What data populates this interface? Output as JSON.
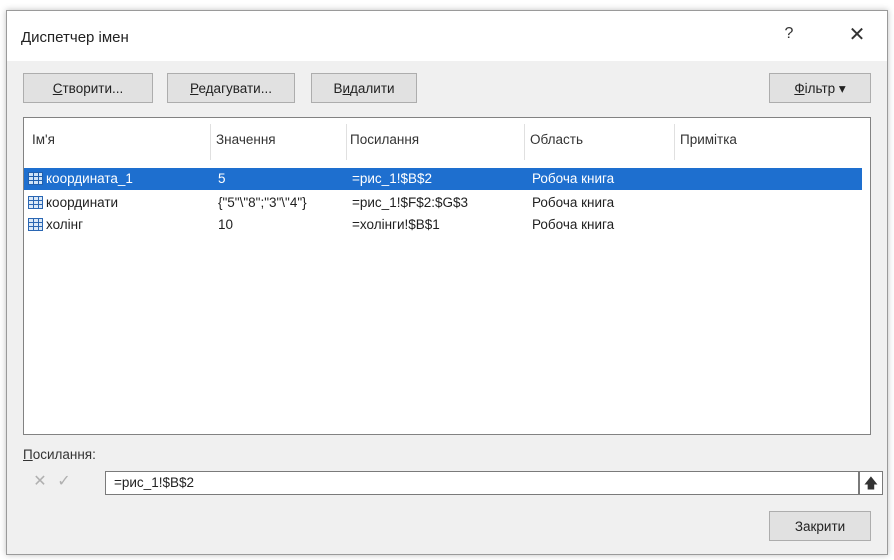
{
  "window": {
    "title": "Диспетчер імен",
    "help": "?",
    "close": "✕"
  },
  "toolbar": {
    "create_u": "С",
    "create_rest": "творити...",
    "edit_u": "Р",
    "edit_rest": "едагувати...",
    "delete_pre": "В",
    "delete_u": "и",
    "delete_rest": "далити",
    "filter_u": "Ф",
    "filter_rest": "ільтр ▾"
  },
  "list": {
    "columns": [
      "Ім'я",
      "Значення",
      "Посилання",
      "Область",
      "Примітка"
    ],
    "rows": [
      {
        "name": "координата_1",
        "value": "5",
        "ref": "=рис_1!$B$2",
        "scope": "Робоча книга",
        "comment": "",
        "selected": true
      },
      {
        "name": "координати",
        "value": "{\"5\"\\\"8\";\"3\"\\\"4\"}",
        "ref": "=рис_1!$F$2:$G$3",
        "scope": "Робоча книга",
        "comment": "",
        "selected": false
      },
      {
        "name": "холінг",
        "value": "10",
        "ref": "=холінги!$B$1",
        "scope": "Робоча книга",
        "comment": "",
        "selected": false
      }
    ]
  },
  "refers_to": {
    "label_u": "П",
    "label_rest": "осилання:",
    "value": "=рис_1!$B$2",
    "cancel_icon": "✕",
    "confirm_icon": "✓",
    "collapse_icon": "🡅"
  },
  "footer": {
    "close_label": "Закрити"
  }
}
